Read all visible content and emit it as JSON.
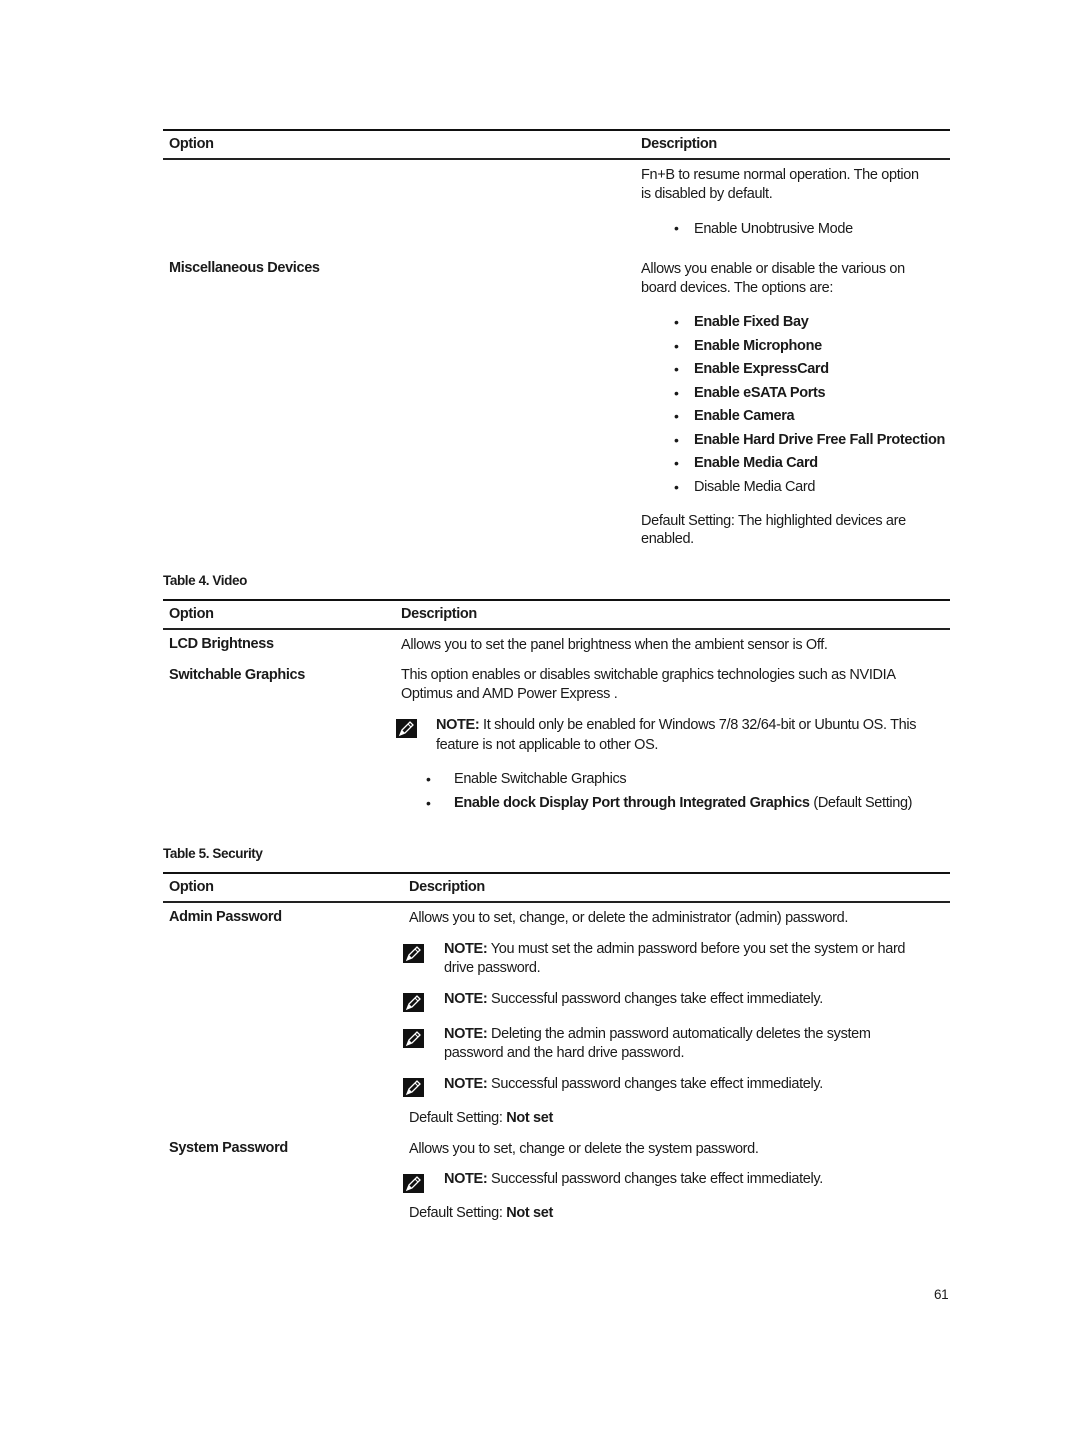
{
  "table_continued": {
    "headers": {
      "option": "Option",
      "description": "Description"
    },
    "continuation_text": "Fn+B to resume normal operation. The option is disabled by default.",
    "continuation_line1": "Fn+B to resume normal operation. The option",
    "continuation_line2": "is disabled by default.",
    "continuation_bullet": "Enable Unobtrusive Mode",
    "rows": [
      {
        "option": "Miscellaneous Devices",
        "description_line1": "Allows you enable or disable the various on",
        "description_line2": "board devices. The options are:",
        "bullets": [
          {
            "label": "Enable Fixed Bay",
            "highlighted": true
          },
          {
            "label": "Enable Microphone",
            "highlighted": true
          },
          {
            "label": "Enable ExpressCard",
            "highlighted": true
          },
          {
            "label": "Enable eSATA Ports",
            "highlighted": true
          },
          {
            "label": "Enable Camera",
            "highlighted": true
          },
          {
            "label": "Enable Hard Drive Free Fall Protection",
            "highlighted": true
          },
          {
            "label": "Enable Media Card",
            "highlighted": true
          },
          {
            "label": "Disable Media Card",
            "highlighted": false
          }
        ],
        "default_line1": "Default Setting: The highlighted devices are",
        "default_line2": "enabled."
      }
    ]
  },
  "table4": {
    "caption": "Table 4. Video",
    "headers": {
      "option": "Option",
      "description": "Description"
    },
    "rows": [
      {
        "option": "LCD Brightness",
        "description": "Allows you to set the panel brightness when the ambient sensor is Off."
      },
      {
        "option": "Switchable Graphics",
        "description_line1": "This option enables or disables switchable graphics technologies such as NVIDIA",
        "description_line2": "Optimus and AMD Power Express .",
        "note_label": "NOTE:",
        "note_line1": " It should only be enabled for Windows 7/8 32/64-bit or Ubuntu OS. This",
        "note_line2": "feature is not applicable to other OS.",
        "bullets": [
          {
            "label": "Enable Switchable Graphics",
            "suffix": ""
          },
          {
            "label": "Enable dock Display Port through Integrated Graphics",
            "suffix": " (Default Setting)"
          }
        ]
      }
    ]
  },
  "table5": {
    "caption": "Table 5. Security",
    "headers": {
      "option": "Option",
      "description": "Description"
    },
    "rows": [
      {
        "option": "Admin Password",
        "description": "Allows you to set, change, or delete the administrator (admin) password.",
        "notes": [
          {
            "label": "NOTE:",
            "line1": " You must set the admin password before you set the system or hard",
            "line2": "drive password."
          },
          {
            "label": "NOTE:",
            "line1": " Successful password changes take effect immediately.",
            "line2": ""
          },
          {
            "label": "NOTE:",
            "line1": " Deleting the admin password automatically deletes the system",
            "line2": "password and the hard drive password."
          },
          {
            "label": "NOTE:",
            "line1": " Successful password changes take effect immediately.",
            "line2": ""
          }
        ],
        "default_prefix": "Default Setting: ",
        "default_value": "Not set"
      },
      {
        "option": "System Password",
        "description": "Allows you to set, change or delete the system password.",
        "notes": [
          {
            "label": "NOTE:",
            "line1": " Successful password changes take effect immediately.",
            "line2": ""
          }
        ],
        "default_prefix": "Default Setting: ",
        "default_value": "Not set"
      }
    ]
  },
  "footer": {
    "page_number": "61"
  },
  "icons": {
    "note": "pencil-note-icon",
    "bullet": "•"
  }
}
